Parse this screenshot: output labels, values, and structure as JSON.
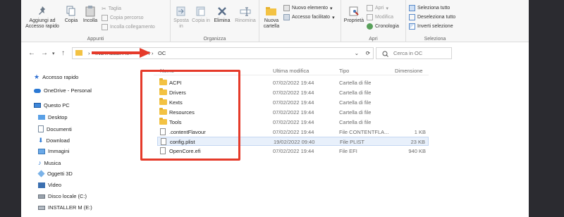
{
  "ribbon": {
    "clipboard": {
      "pin_label": "Aggiungi ad Accesso rapido",
      "copy_label": "Copia",
      "paste_label": "Incolla",
      "cut_label": "Taglia",
      "copy_path_label": "Copia percorso",
      "paste_link_label": "Incolla collegamento",
      "group_label": "Appunti"
    },
    "organize": {
      "move_label": "Sposta in",
      "copy_to_label": "Copia in",
      "delete_label": "Elimina",
      "rename_label": "Rinomina",
      "group_label": "Organizza"
    },
    "new": {
      "new_folder_label": "Nuova cartella",
      "new_item_label": "Nuovo elemento",
      "easy_access_label": "Accesso facilitato"
    },
    "open": {
      "properties_label": "Proprietà",
      "open_label": "Apri",
      "edit_label": "Modifica",
      "history_label": "Cronologia",
      "group_label": "Apri"
    },
    "select": {
      "select_all_label": "Seleziona tutto",
      "select_none_label": "Deseleziona tutto",
      "invert_label": "Inverti selezione",
      "group_label": "Seleziona"
    }
  },
  "address": {
    "crumbs": [
      "INSTALLER M",
      "EFI",
      "OC"
    ],
    "search_placeholder": "Cerca in OC"
  },
  "sidebar": {
    "items": [
      {
        "label": "Accesso rapido",
        "icon": "star-icon"
      },
      {
        "label": "OneDrive - Personal",
        "icon": "cloud-icon"
      },
      {
        "label": "Questo PC",
        "icon": "computer-icon"
      },
      {
        "label": "Desktop",
        "icon": "desktop-icon"
      },
      {
        "label": "Documenti",
        "icon": "documents-icon"
      },
      {
        "label": "Download",
        "icon": "download-icon"
      },
      {
        "label": "Immagini",
        "icon": "pictures-icon"
      },
      {
        "label": "Musica",
        "icon": "music-icon"
      },
      {
        "label": "Oggetti 3D",
        "icon": "cube-icon"
      },
      {
        "label": "Video",
        "icon": "video-icon"
      },
      {
        "label": "Disco locale (C:)",
        "icon": "drive-icon"
      },
      {
        "label": "INSTALLER M (E:)",
        "icon": "usb-drive-icon"
      }
    ]
  },
  "columns": {
    "name": "Nome",
    "date": "Ultima modifica",
    "type": "Tipo",
    "size": "Dimensione"
  },
  "files": [
    {
      "name": "ACPI",
      "date": "07/02/2022 19:44",
      "type": "Cartella di file",
      "size": "",
      "kind": "folder"
    },
    {
      "name": "Drivers",
      "date": "07/02/2022 19:44",
      "type": "Cartella di file",
      "size": "",
      "kind": "folder"
    },
    {
      "name": "Kexts",
      "date": "07/02/2022 19:44",
      "type": "Cartella di file",
      "size": "",
      "kind": "folder"
    },
    {
      "name": "Resources",
      "date": "07/02/2022 19:44",
      "type": "Cartella di file",
      "size": "",
      "kind": "folder"
    },
    {
      "name": "Tools",
      "date": "07/02/2022 19:44",
      "type": "Cartella di file",
      "size": "",
      "kind": "folder"
    },
    {
      "name": ".contentFlavour",
      "date": "07/02/2022 19:44",
      "type": "File CONTENTFLA...",
      "size": "1 KB",
      "kind": "file"
    },
    {
      "name": "config.plist",
      "date": "19/02/2022 09:40",
      "type": "File PLIST",
      "size": "23 KB",
      "kind": "file"
    },
    {
      "name": "OpenCore.efi",
      "date": "07/02/2022 19:44",
      "type": "File EFI",
      "size": "940 KB",
      "kind": "file"
    }
  ],
  "colors": {
    "highlight": "#e53a2a",
    "folder": "#f3c243",
    "selection": "#e8f0fb"
  }
}
